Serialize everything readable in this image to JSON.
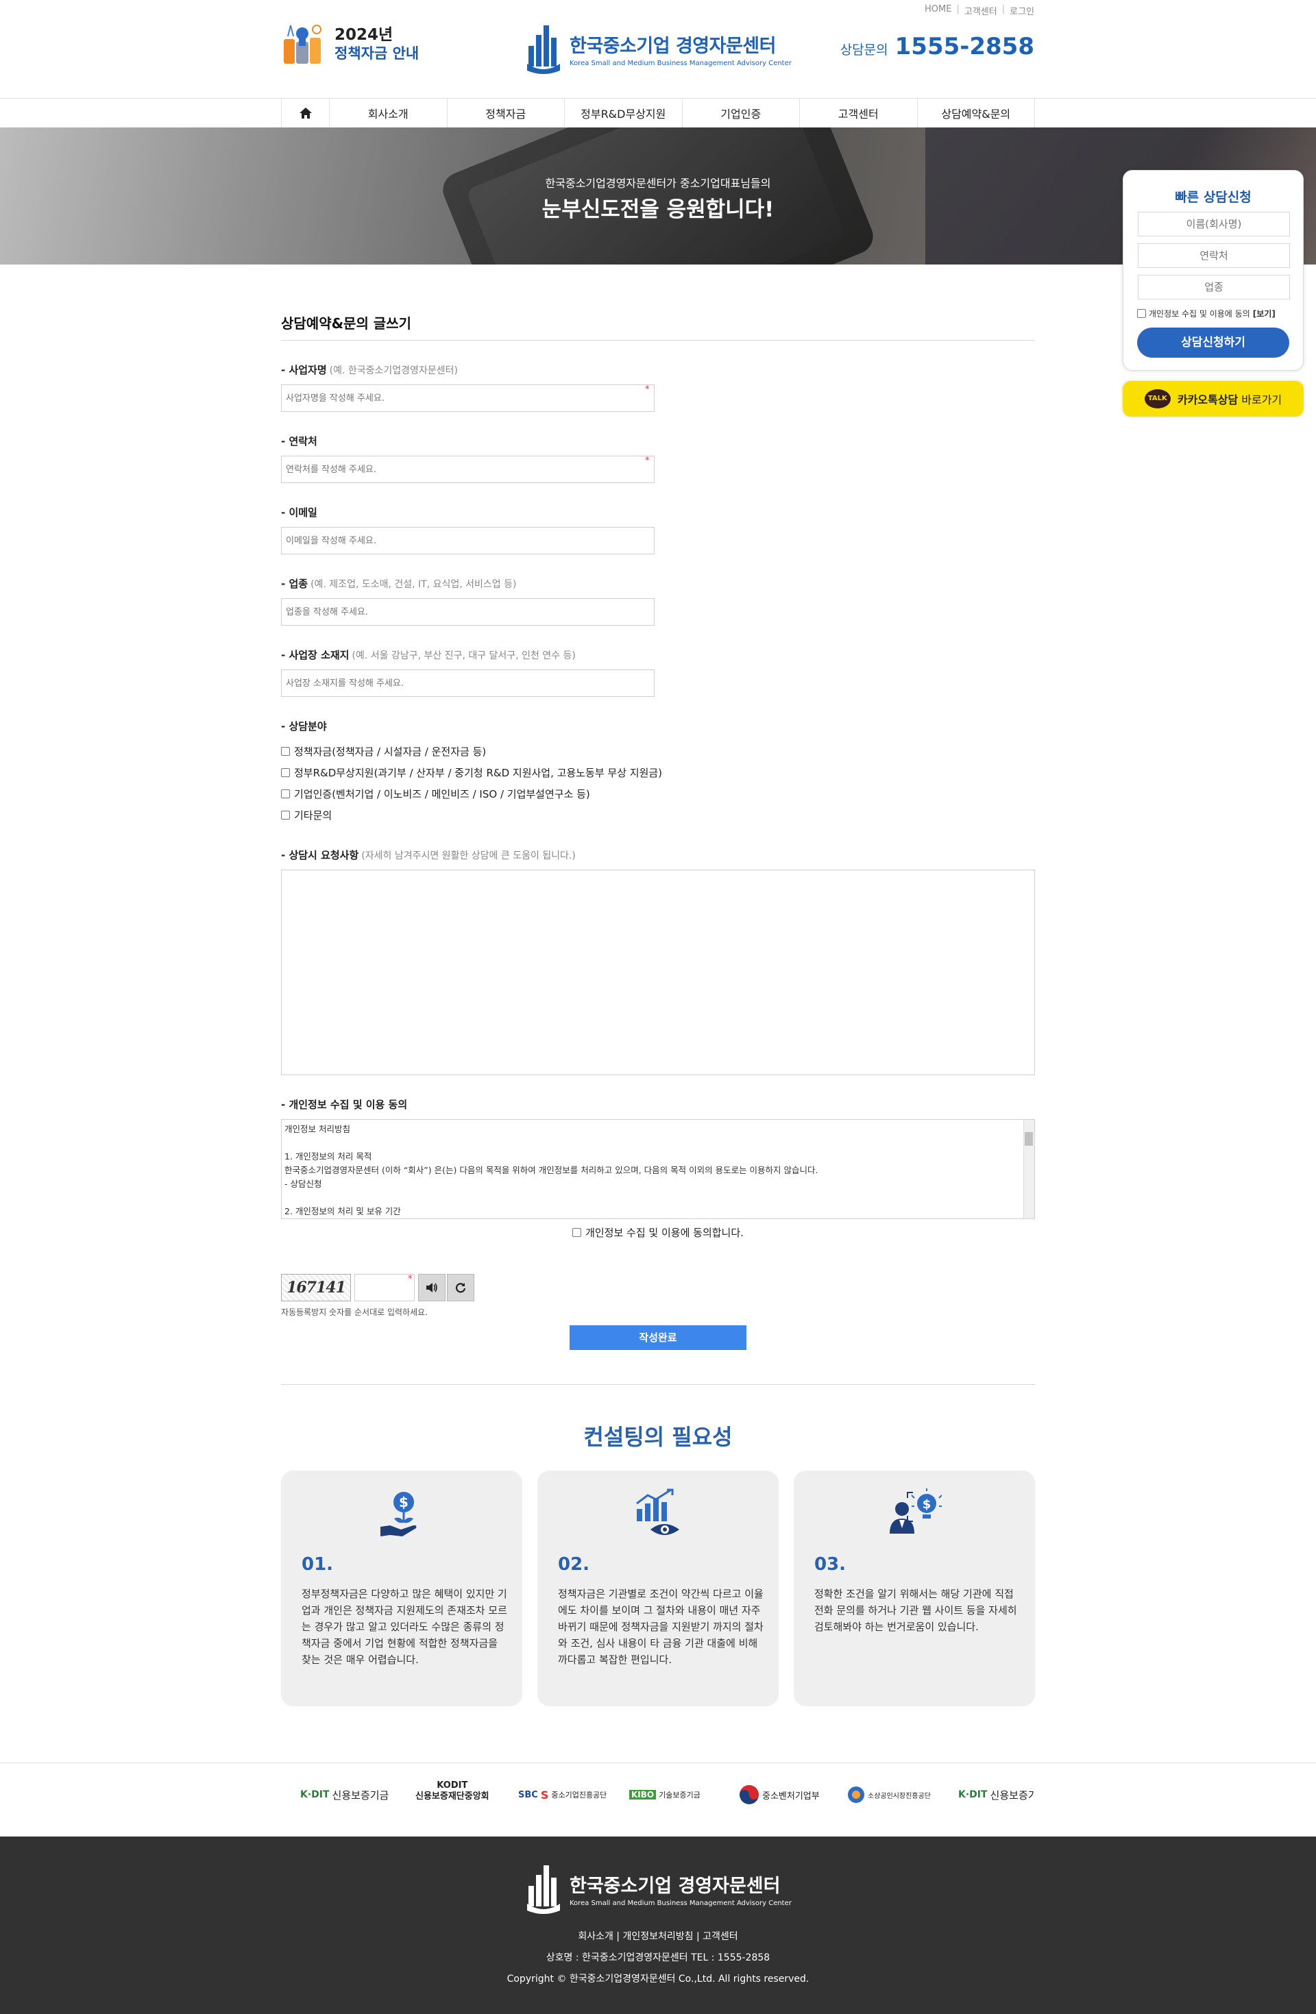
{
  "util": {
    "home": "HOME",
    "customer": "고객센터",
    "login": "로그인"
  },
  "header": {
    "policy_year": "2024년",
    "policy_sub": "정책자금 안내",
    "logo_ko": "한국중소기업 경영자문센터",
    "logo_en": "Korea Small and Medium Business Management Advisory Center",
    "phone_label": "상담문의",
    "phone_number": "1555-2858"
  },
  "nav": [
    "회사소개",
    "정책자금",
    "정부R&D무상지원",
    "기업인증",
    "고객센터",
    "상담예약&문의"
  ],
  "banner": {
    "line1": "한국중소기업경영자문센터가 중소기업대표님들의",
    "line2": "눈부신도전을 응원합니다!"
  },
  "quick": {
    "title": "빠른 상담신청",
    "name_ph": "이름(회사명)",
    "phone_ph": "연락처",
    "biz_ph": "업종",
    "agree": "개인정보 수집 및 이용에 동의",
    "view": "[보기]",
    "button": "상담신청하기"
  },
  "kakao": {
    "bold": "카카오톡상담",
    "rest": "바로가기",
    "talk": "TALK"
  },
  "form": {
    "title": "상담예약&문의 글쓰기",
    "fields": [
      {
        "label": "- 사업자명",
        "example": "(예. 한국중소기업경영자문센터)",
        "placeholder": "사업자명을 작성해 주세요."
      },
      {
        "label": "- 연락처",
        "example": "",
        "placeholder": "연락처를 작성해 주세요."
      },
      {
        "label": "- 이메일",
        "example": "",
        "placeholder": "이메일을 작성해 주세요."
      },
      {
        "label": "- 업종",
        "example": "(예. 제조업, 도소매, 건설, IT, 요식업, 서비스업 등)",
        "placeholder": "업종을 작성해 주세요."
      },
      {
        "label": "- 사업장 소재지",
        "example": "(예. 서울 강남구, 부산 진구, 대구 달서구, 인천 연수 등)",
        "placeholder": "사업장 소재지를 작성해 주세요."
      }
    ],
    "category_label": "- 상담분야",
    "categories": [
      "정책자금(정책자금 / 시설자금 / 운전자금 등)",
      "정부R&D무상지원(과기부 / 산자부 / 중기청 R&D 지원사업, 고용노동부 무상 지원금)",
      "기업인증(벤처기업 / 이노비즈 / 메인비즈 / ISO / 기업부설연구소 등)",
      "기타문의"
    ],
    "request_label": "- 상담시 요청사항",
    "request_example": "(자세히 남겨주시면 원활한 상담에 큰 도움이 됩니다.)",
    "privacy_label": "- 개인정보 수집 및 이용 동의",
    "privacy_lines": [
      "개인정보 처리방침",
      "",
      "1. 개인정보의 처리 목적",
      "한국중소기업경영자문센터 (이하 “회사”) 은(는) 다음의 목적을 위하여 개인정보를 처리하고 있으며, 다음의 목적 이외의 용도로는 이용하지 않습니다.",
      "- 상담신청",
      "",
      "2. 개인정보의 처리 및 보유 기간"
    ],
    "agree": "개인정보 수집 및 이용에 동의합니다.",
    "captcha_text": "167141",
    "captcha_help": "자동등록방지 숫자를 순서대로 입력하세요.",
    "submit": "작성완료"
  },
  "consulting": {
    "title": "컨설팅의 필요성",
    "cards": [
      {
        "num": "01.",
        "icon": "money-hand-icon",
        "desc": "정부정책자금은 다양하고 많은 혜택이 있지만 기업과 개인은 정책자금 지원제도의 존재조차 모르는 경우가 많고 알고 있더라도 수많은 종류의 정책자금 중에서 기업 현황에 적합한 정책자금을 찾는 것은 매우 어렵습니다."
      },
      {
        "num": "02.",
        "icon": "chart-eye-icon",
        "desc": "정책자금은 기관별로 조건이 약간씩 다르고 이율에도 차이를 보이며 그 절차와 내용이 매년 자주 바뀌기 때문에 정책자금을 지원받기 까지의 절차와 조건, 심사 내용이 타 금융 기관 대출에 비해 까다롭고 복잡한 편입니다."
      },
      {
        "num": "03.",
        "icon": "consultant-idea-icon",
        "desc": "정확한 조건을 알기 위해서는 해당 기관에 직접 전화 문의를 하거나 기관 웹 사이트 등을 자세히 검토해봐야 하는 번거로움이 있습니다."
      }
    ]
  },
  "partners": [
    {
      "mark": "K·DIT",
      "name": "신용보증기금"
    },
    {
      "mark": "KODIT",
      "name": "신용보증재단중앙회"
    },
    {
      "mark": "SBC",
      "name": "중소기업진흥공단"
    },
    {
      "mark": "KIBO",
      "name": "기술보증기금"
    },
    {
      "mark": "",
      "name": "중소벤처기업부"
    },
    {
      "mark": "",
      "name": "소상공인시장진흥공단"
    },
    {
      "mark": "K·DIT",
      "name": "신용보증기"
    }
  ],
  "footer": {
    "links": "회사소개 | 개인정보처리방침 | 고객센터",
    "info": "상호명 : 한국중소기업경영자문센터    TEL : 1555-2858",
    "copy": "Copyright © 한국중소기업경영자문센터 Co.,Ltd. All rights reserved."
  },
  "colors": {
    "brand": "#1f62b4",
    "submit": "#3d86ec",
    "kakao": "#f9e000",
    "footer": "#323232"
  }
}
